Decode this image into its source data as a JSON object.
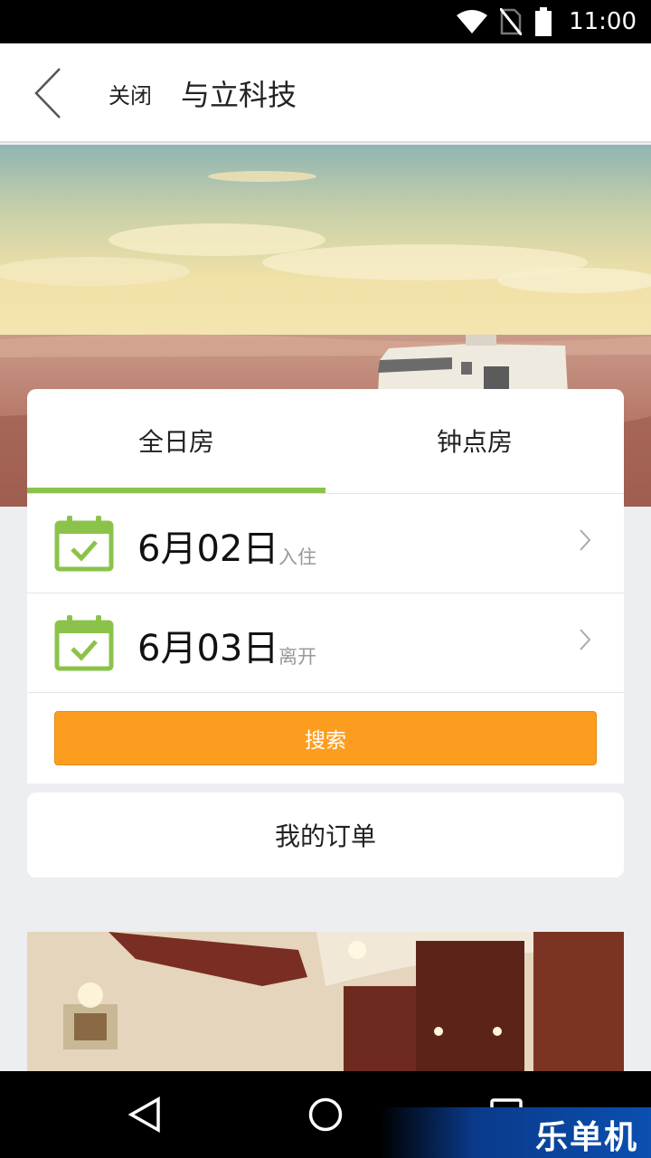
{
  "status_bar": {
    "time": "11:00",
    "icons": [
      "wifi-icon",
      "no-sim-icon",
      "battery-icon"
    ]
  },
  "nav": {
    "close_label": "关闭",
    "title": "与立科技"
  },
  "booking": {
    "tabs": [
      {
        "label": "全日房",
        "selected": true
      },
      {
        "label": "钟点房",
        "selected": false
      }
    ],
    "checkin": {
      "date": "6月02日",
      "hint": "入住"
    },
    "checkout": {
      "date": "6月03日",
      "hint": "离开"
    },
    "search_label": "搜索"
  },
  "orders_label": "我的订单",
  "watermark": "乐单机",
  "colors": {
    "accent_green": "#8bc34a",
    "search_orange": "#fd9d1f"
  }
}
